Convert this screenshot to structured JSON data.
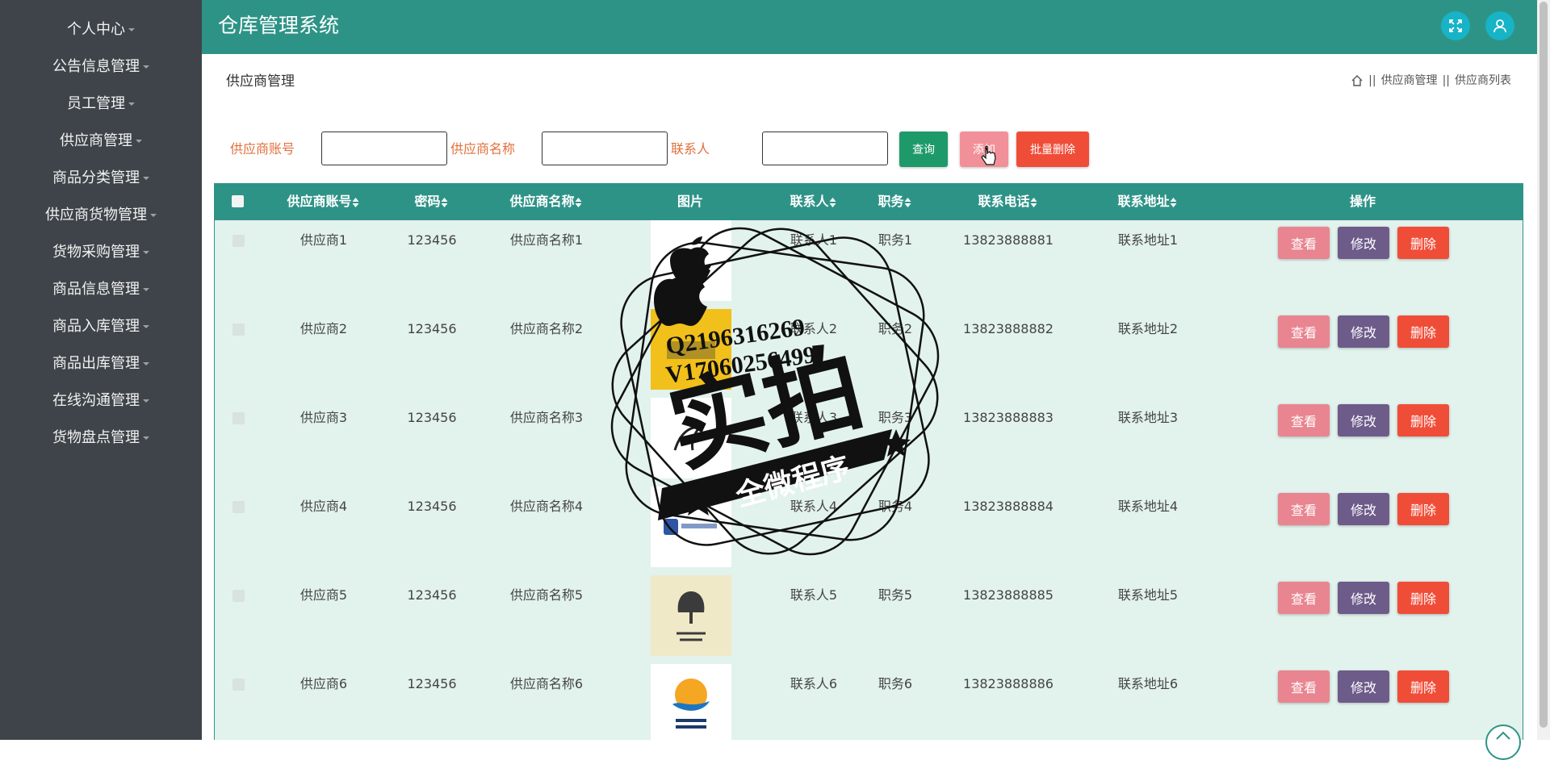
{
  "app": {
    "title": "仓库管理系统"
  },
  "sidebar": {
    "items": [
      {
        "label": "个人中心"
      },
      {
        "label": "公告信息管理"
      },
      {
        "label": "员工管理"
      },
      {
        "label": "供应商管理"
      },
      {
        "label": "商品分类管理"
      },
      {
        "label": "供应商货物管理"
      },
      {
        "label": "货物采购管理"
      },
      {
        "label": "商品信息管理"
      },
      {
        "label": "商品入库管理"
      },
      {
        "label": "商品出库管理"
      },
      {
        "label": "在线沟通管理"
      },
      {
        "label": "货物盘点管理"
      }
    ]
  },
  "header": {
    "fullscreen_icon": "expand-icon",
    "user_icon": "user-icon",
    "accent": "#2e9387"
  },
  "page": {
    "title": "供应商管理",
    "breadcrumb": [
      "供应商管理",
      "供应商列表"
    ],
    "breadcrumb_sep": "||"
  },
  "search": {
    "account_label": "供应商账号",
    "account_value": "",
    "name_label": "供应商名称",
    "name_value": "",
    "contact_label": "联系人",
    "contact_value": "",
    "query_button": "查询",
    "add_button": "添加",
    "batch_delete_button": "批量删除"
  },
  "table": {
    "columns": [
      "供应商账号",
      "密码",
      "供应商名称",
      "图片",
      "联系人",
      "职务",
      "联系电话",
      "联系地址",
      "操作"
    ],
    "rows": [
      {
        "account": "供应商1",
        "password": "123456",
        "name": "供应商名称1",
        "contact": "联系人1",
        "position": "职务1",
        "phone": "13823888881",
        "address": "联系地址1",
        "image": "apple-logo"
      },
      {
        "account": "供应商2",
        "password": "123456",
        "name": "供应商名称2",
        "contact": "联系人2",
        "position": "职务2",
        "phone": "13823888882",
        "address": "联系地址2",
        "image": "yunda-logo"
      },
      {
        "account": "供应商3",
        "password": "123456",
        "name": "供应商名称3",
        "contact": "联系人3",
        "position": "职务3",
        "phone": "13823888883",
        "address": "联系地址3",
        "image": "brand-logo"
      },
      {
        "account": "供应商4",
        "password": "123456",
        "name": "供应商名称4",
        "contact": "联系人4",
        "position": "职务4",
        "phone": "13823888884",
        "address": "联系地址4",
        "image": "tech-logo"
      },
      {
        "account": "供应商5",
        "password": "123456",
        "name": "供应商名称5",
        "contact": "联系人5",
        "position": "职务5",
        "phone": "13823888885",
        "address": "联系地址5",
        "image": "tree-logo"
      },
      {
        "account": "供应商6",
        "password": "123456",
        "name": "供应商名称6",
        "contact": "联系人6",
        "position": "职务6",
        "phone": "13823888886",
        "address": "联系地址6",
        "image": "bird-logo"
      }
    ],
    "actions": {
      "view": "查看",
      "edit": "修改",
      "delete": "删除"
    }
  },
  "watermark": {
    "qq": "Q2196316269",
    "wechat": "V17060256499",
    "main": "实拍",
    "ribbon": "全微程序"
  }
}
